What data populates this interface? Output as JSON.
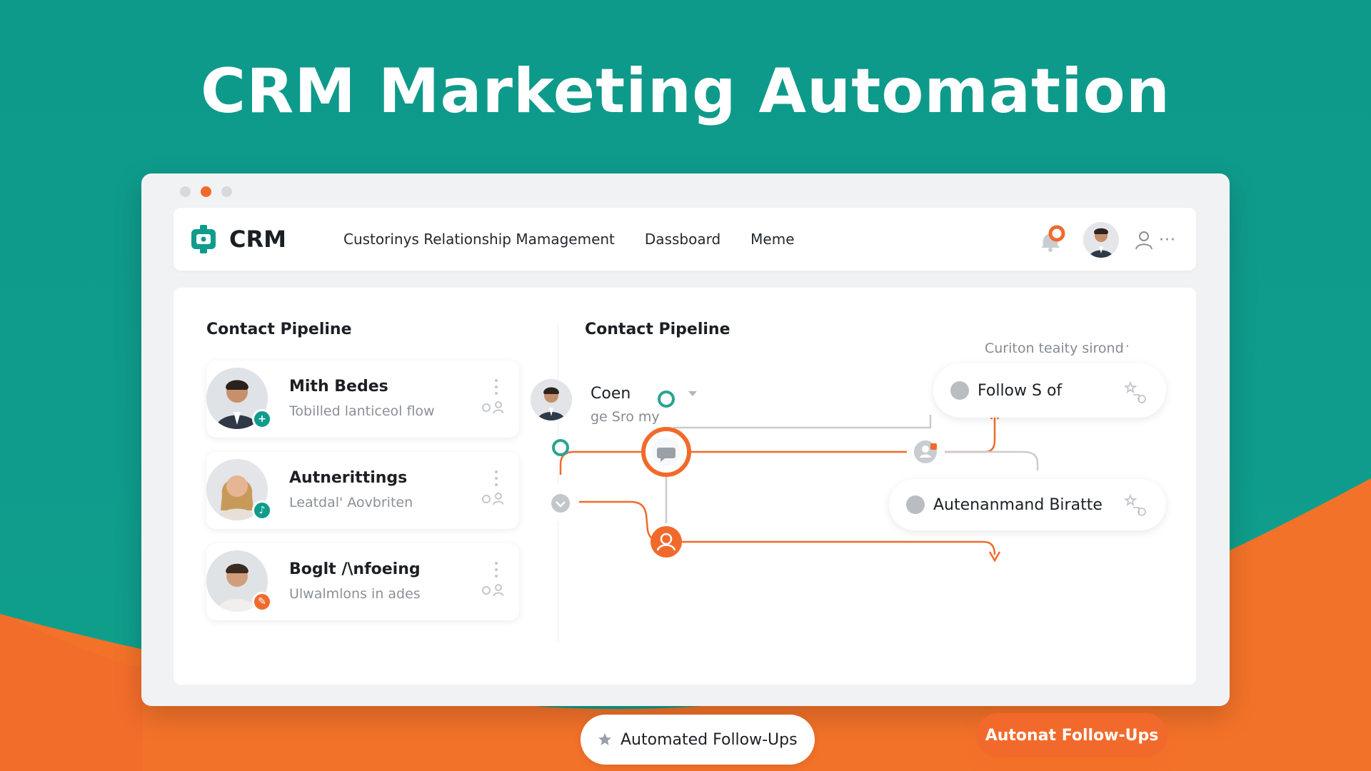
{
  "hero": {
    "title": "CRM Marketing Automation"
  },
  "window": {
    "dots": [
      "close",
      "minimize",
      "maximize"
    ]
  },
  "topbar": {
    "logo_text": "CRM",
    "nav": [
      {
        "label": "Custorinys Relationship Mamagement"
      },
      {
        "label": "Dassboard"
      },
      {
        "label": "Meme"
      }
    ],
    "more_label": "···"
  },
  "left_panel": {
    "title": "Contact Pipeline",
    "contacts": [
      {
        "name": "Mith Bedes",
        "subtitle": "Tobilled lanticeol flow",
        "badge_color": "#0f9c8c",
        "badge_glyph": "+"
      },
      {
        "name": "Autnerittings",
        "subtitle": "Leatdal' Aovbriten",
        "badge_color": "#0f9c8c",
        "badge_glyph": "♪"
      },
      {
        "name": "Boglt /\\nfoeing",
        "subtitle": "Ulwalmlons in ades",
        "badge_color": "#f26a2b",
        "badge_glyph": "✎"
      }
    ]
  },
  "right_panel": {
    "title": "Contact Pipeline",
    "filter_label": "Curiton teaity sirond",
    "filter_more": "···",
    "selected_contact": {
      "name": "Coen",
      "subtitle": "ge Sro my"
    },
    "nodes": {
      "follow_label": "Follow S of",
      "autenanmand_label": "Autenanmand Biratte",
      "automated_label": "Automated Follow-Ups",
      "cta_label": "Autonat Follow-Ups"
    }
  },
  "colors": {
    "teal": "#0f9c8c",
    "orange": "#f26a2b",
    "window_bg": "#f1f2f4",
    "panel_bg": "#ffffff"
  },
  "icons": {
    "logo": "crm-logo-icon",
    "bell": "notification-bell-icon",
    "user": "user-icon",
    "chat": "chat-bubble-icon",
    "star": "star-icon",
    "check": "chevron-down-icon",
    "person": "person-icon"
  }
}
